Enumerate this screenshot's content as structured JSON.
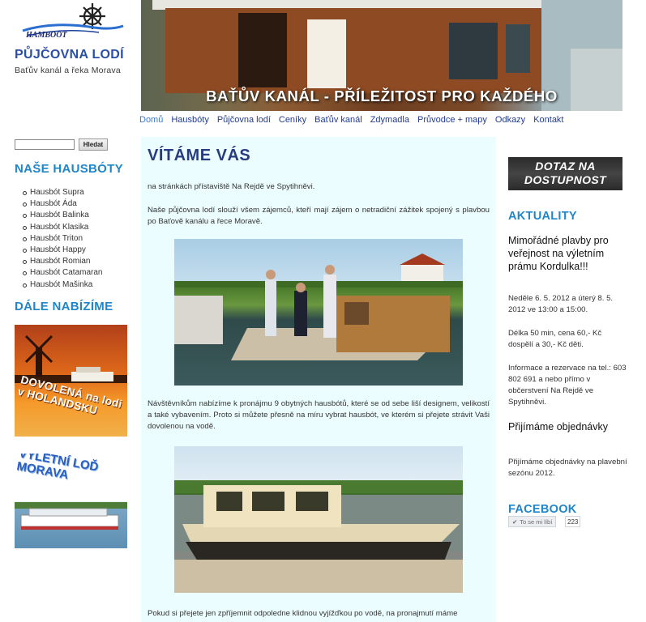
{
  "header": {
    "logo_text": "HAMBOOT",
    "site_title": "PŮJČOVNA LODÍ",
    "site_subtitle": "Baťův kanál a řeka Morava",
    "banner_text": "BAŤŮV KANÁL - PŘÍLEŽITOST PRO KAŽDÉHO"
  },
  "nav": {
    "items": [
      {
        "label": "Domů",
        "active": true
      },
      {
        "label": "Hausbóty"
      },
      {
        "label": "Půjčovna lodí"
      },
      {
        "label": "Ceníky"
      },
      {
        "label": "Baťův kanál"
      },
      {
        "label": "Zdymadla"
      },
      {
        "label": "Průvodce + mapy"
      },
      {
        "label": "Odkazy"
      },
      {
        "label": "Kontakt"
      }
    ]
  },
  "search": {
    "value": "",
    "button_label": "Hledat"
  },
  "sidebar": {
    "boats_heading": "NAŠE HAUSBÓTY",
    "boats": [
      "Hausbót Supra",
      "Hausbót Áda",
      "Hausbót Balinka",
      "Hausbót Klasika",
      "Hausbót Triton",
      "Hausbót Happy",
      "Hausbót Romian",
      "Hausbót Catamaran",
      "Hausbót Mašinka"
    ],
    "offers_heading": "DÁLE NABÍZÍME",
    "ad_holland_text": "DOVOLENÁ na lodi v HOLANDSKU",
    "ad_boat_text": "VÝLETNÍ LOĎ MORAVA"
  },
  "main": {
    "title": "VÍTÁME VÁS",
    "para_1": "na stránkách přístaviště Na Rejdě ve Spytihněvi.",
    "para_2": "Naše půjčovna lodí slouží všem zájemců, kteří mají zájem o netradiční zážitek spojený s plavbou po Baťově kanálu a řece Moravě.",
    "para_3": "Návštěvníkům nabízíme k pronájmu 9 obytných hausbótů, které se od sebe liší designem, velikostí a také vybavením. Proto si můžete přesně na míru vybrat hausbót, ve kterém si přejete strávit Vaši dovolenou na vodě.",
    "para_4": "Pokud si přejete jen zpříjemnit odpoledne klidnou vyjížďkou po vodě, na pronajmutí máme"
  },
  "right": {
    "inquiry_button": "DOTAZ NA DOSTUPNOST",
    "news_heading": "AKTUALITY",
    "news_title_1": "Mimořádné plavby pro veřejnost na výletním prámu Kordulka!!!",
    "news_text_1": "Neděle 6. 5. 2012 a úterý 8. 5. 2012 ve 13:00 a 15:00.",
    "news_text_2": "Délka 50 min, cena 60,- Kč dospělí a 30,- Kč děti.",
    "news_text_3": "Informace a rezervace na tel.: 603 802 691 a nebo přímo v občerstvení Na Rejdě ve Spytihněvi.",
    "news_title_2": "Přijímáme objednávky",
    "news_text_4": "Přijímáme objednávky na plavební sezónu 2012.",
    "facebook_heading": "FACEBOOK",
    "fb_like_label": "To se mi líbí",
    "fb_like_count": "223"
  },
  "colors": {
    "accent_blue": "#1f86c9",
    "nav_blue": "#223b8c",
    "content_bg": "#ecfdff",
    "title_navy": "#263b80"
  }
}
